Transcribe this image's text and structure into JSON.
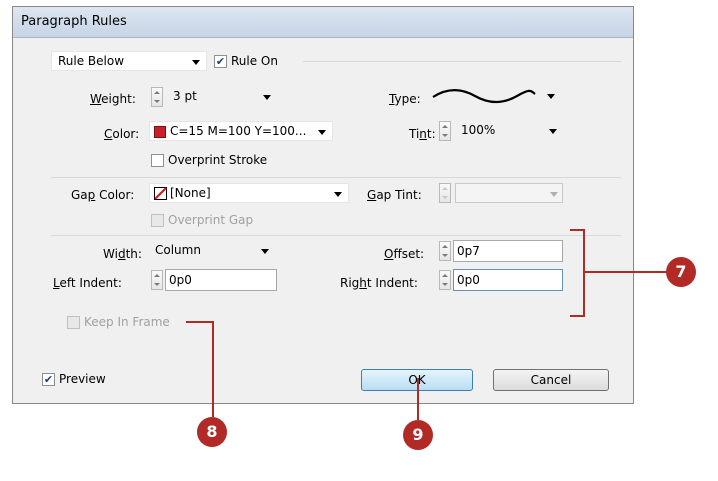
{
  "window": {
    "title": "Paragraph Rules"
  },
  "rule_selector": {
    "value": "Rule Below"
  },
  "rule_on": {
    "label": "Rule On",
    "checked": true
  },
  "weight": {
    "label": "Weight:",
    "value": "3 pt"
  },
  "type": {
    "label": "Type:",
    "style": "wavy"
  },
  "color": {
    "label": "Color:",
    "value": "C=15 M=100 Y=100...",
    "swatch": "#c9202a"
  },
  "tint": {
    "label": "Tint:",
    "value": "100%"
  },
  "overprint_stroke": {
    "label": "Overprint Stroke",
    "checked": false
  },
  "gap_color": {
    "label": "Gap Color:",
    "value": "[None]"
  },
  "gap_tint": {
    "label": "Gap Tint:",
    "value": ""
  },
  "overprint_gap": {
    "label": "Overprint Gap",
    "checked": false,
    "disabled": true
  },
  "width": {
    "label": "Width:",
    "value": "Column"
  },
  "offset": {
    "label": "Offset:",
    "value": "0p7"
  },
  "left_indent": {
    "label": "Left Indent:",
    "value": "0p0"
  },
  "right_indent": {
    "label": "Right Indent:",
    "value": "0p0"
  },
  "keep_in_frame": {
    "label": "Keep In Frame",
    "checked": false,
    "disabled": true
  },
  "preview": {
    "label": "Preview",
    "checked": true
  },
  "buttons": {
    "ok": "OK",
    "cancel": "Cancel"
  },
  "callouts": {
    "seven": "7",
    "eight": "8",
    "nine": "9"
  },
  "colors": {
    "callout": "#b22a26",
    "callout_line": "#b22a26"
  }
}
